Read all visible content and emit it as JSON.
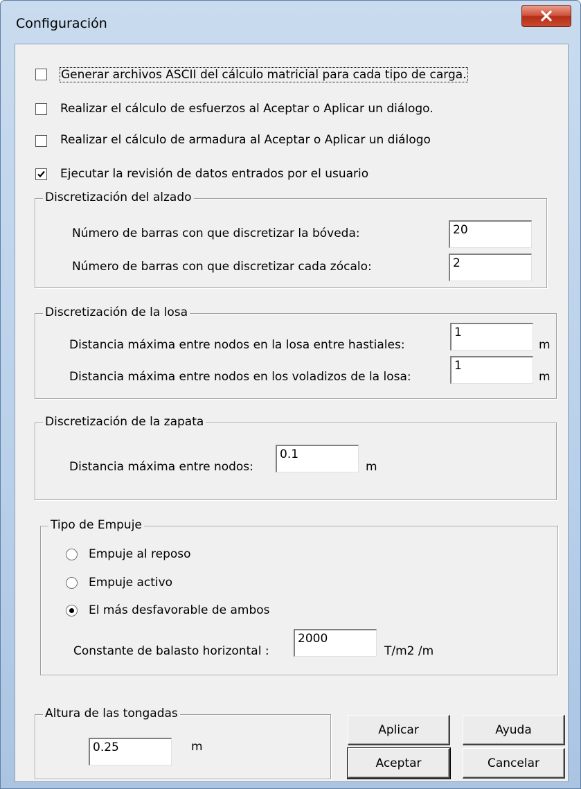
{
  "window": {
    "title": "Configuración"
  },
  "options": {
    "ascii_label": "Generar archivos ASCII del cálculo matricial para cada tipo de carga.",
    "ascii_checked": false,
    "esfuerzos_label": "Realizar el cálculo de esfuerzos al Aceptar o Aplicar un diálogo.",
    "esfuerzos_checked": false,
    "armadura_label": "Realizar el cálculo de armadura al Aceptar o Aplicar un diálogo",
    "armadura_checked": false,
    "revision_label": "Ejecutar la revisión de datos entrados por el usuario",
    "revision_checked": true
  },
  "alzado": {
    "title": "Discretización del alzado",
    "boveda_label": "Número de barras con que discretizar la bóveda:",
    "boveda_value": "20",
    "zocalo_label": "Número de barras con que discretizar cada zócalo:",
    "zocalo_value": "2"
  },
  "losa": {
    "title": "Discretización de la losa",
    "hastiales_label": "Distancia máxima entre nodos en la losa entre hastiales:",
    "hastiales_value": "1",
    "hastiales_unit": "m",
    "voladizos_label": "Distancia máxima entre nodos en los voladizos de la losa:",
    "voladizos_value": "1",
    "voladizos_unit": "m"
  },
  "zapata": {
    "title": "Discretización de la zapata",
    "nodos_label": "Distancia máxima entre nodos:",
    "nodos_value": "0.1",
    "nodos_unit": "m"
  },
  "empuje": {
    "title": "Tipo de Empuje",
    "options": [
      {
        "label": "Empuje al reposo",
        "selected": false
      },
      {
        "label": "Empuje activo",
        "selected": false
      },
      {
        "label": "El más desfavorable de ambos",
        "selected": true
      }
    ],
    "balasto_label": "Constante de balasto horizontal :",
    "balasto_value": "2000",
    "balasto_unit": "T/m2 /m"
  },
  "tongadas": {
    "title": "Altura de las tongadas",
    "value": "0.25",
    "unit": "m"
  },
  "buttons": {
    "aplicar": "Aplicar",
    "ayuda": "Ayuda",
    "aceptar": "Aceptar",
    "cancelar": "Cancelar"
  }
}
